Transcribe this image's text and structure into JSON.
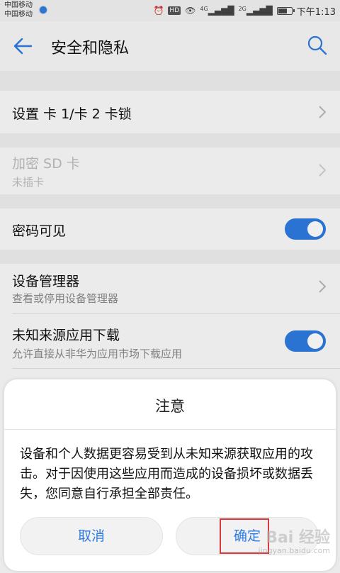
{
  "status_bar": {
    "carrier1": "中国移动",
    "carrier2": "中国移动",
    "hd_badge": "HD",
    "net1": "4G",
    "net2": "2G",
    "battery_level": 0.6,
    "time": "下午1:13"
  },
  "app_bar": {
    "title": "安全和隐私",
    "back_icon": "back-arrow-icon",
    "search_icon": "search-icon"
  },
  "settings": {
    "sim_lock": {
      "label": "设置 卡 1/卡 2 卡锁"
    },
    "sd_encrypt": {
      "label": "加密 SD 卡",
      "sub": "未插卡",
      "disabled": true
    },
    "password_visible": {
      "label": "密码可见",
      "on": true
    },
    "device_admin": {
      "label": "设备管理器",
      "sub": "查看或停用设备管理器"
    },
    "unknown_sources": {
      "label": "未知来源应用下载",
      "sub": "允许直接从非华为应用市场下载应用",
      "on": true
    }
  },
  "dialog": {
    "title": "注意",
    "body": "设备和个人数据更容易受到从未知来源获取应用的攻击。对于因使用这些应用而造成的设备损坏或数据丢失，您同意自行承担全部责任。",
    "cancel_label": "取消",
    "ok_label": "确定"
  },
  "watermark": {
    "text": "Bai 经验",
    "sub": "jingyan.baidu.com"
  },
  "colors": {
    "accent": "#2d7be0",
    "highlight": "#d93a3a"
  }
}
